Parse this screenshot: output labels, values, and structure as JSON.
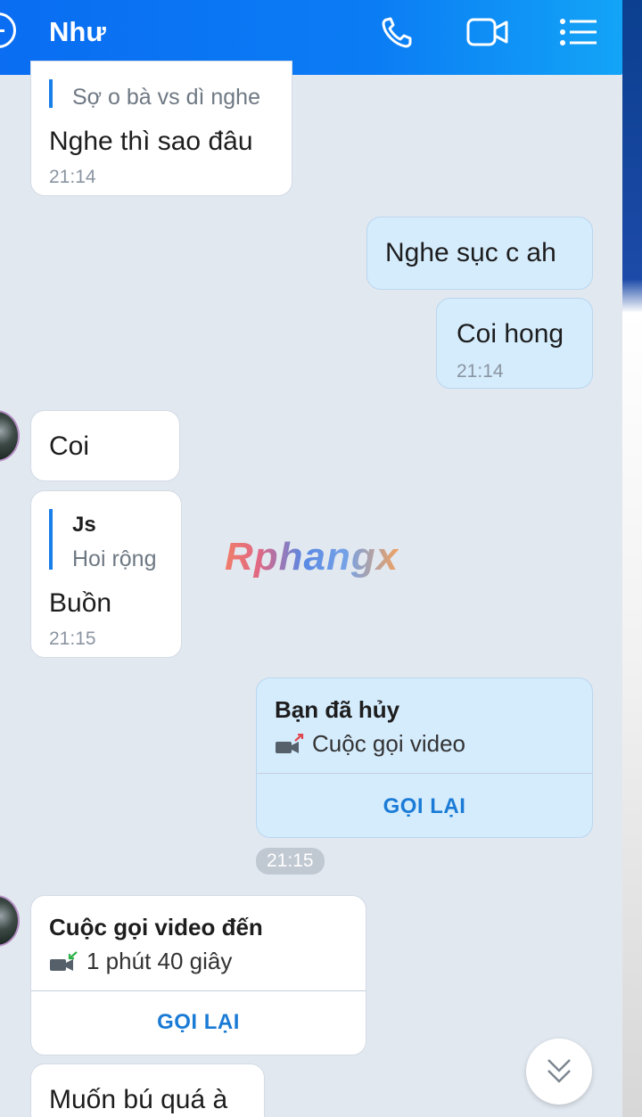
{
  "header": {
    "title": "Như",
    "back_icon": "back-arrow-icon",
    "phone_icon": "phone-icon",
    "video_icon": "video-camera-icon",
    "menu_icon": "list-menu-icon",
    "gradient_start": "#0a6df2",
    "gradient_end": "#13a4f7"
  },
  "messages": [
    {
      "side": "incoming",
      "quote_text": "Sợ o bà vs dì nghe",
      "text": "Nghe thì sao đâu",
      "time": "21:14"
    },
    {
      "side": "outgoing",
      "text": "Nghe sục c ah"
    },
    {
      "side": "outgoing",
      "text": "Coi hong",
      "time": "21:14"
    },
    {
      "side": "incoming",
      "text": "Coi"
    },
    {
      "side": "incoming",
      "quote_name": "Js",
      "quote_text": "Hoi rộng",
      "text": "Buồn",
      "time": "21:15"
    },
    {
      "side": "outgoing",
      "call_title": "Bạn đã hủy",
      "call_sub": "Cuộc gọi video",
      "action": "GỌI LẠI"
    },
    {
      "side": "incoming",
      "call_title": "Cuộc gọi video đến",
      "call_sub": "1 phút 40 giây",
      "action": "GỌI LẠI"
    },
    {
      "side": "incoming",
      "text": "Muốn bú quá à"
    }
  ],
  "time_pill": "21:15",
  "watermark": "Rphangx",
  "scroll_down_icon": "double-chevron-down-icon",
  "colors": {
    "accent": "#1a7bd6",
    "outgoing_bubble": "#d5ecfd",
    "incoming_bubble": "#ffffff",
    "background": "#e2e8f0"
  }
}
